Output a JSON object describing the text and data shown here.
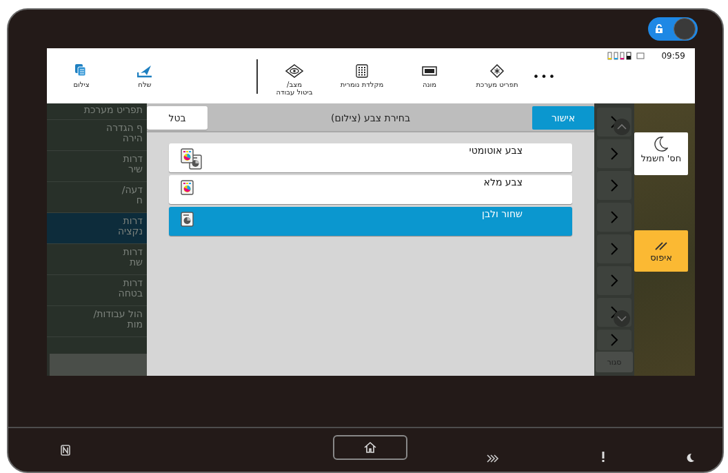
{
  "lock_toggle": {
    "on": true
  },
  "status_bar": {
    "time": "09:59"
  },
  "top_bar": {
    "more": "•••",
    "functions": [
      {
        "kind": "system-menu",
        "label": "תפריט מערכת"
      },
      {
        "kind": "counter",
        "label": "מונה"
      },
      {
        "kind": "keypad",
        "label": "מקלדת נומרית"
      },
      {
        "kind": "status",
        "label": "מצב/\nביטול עבודה"
      }
    ],
    "shortcuts": [
      {
        "kind": "send",
        "label": "שלח"
      },
      {
        "kind": "copy",
        "label": "צילום"
      }
    ]
  },
  "side_panel": [
    {
      "kind": "energy",
      "label": "חס' חשמל"
    },
    {
      "kind": "reset",
      "label": "איפוס"
    }
  ],
  "menu": {
    "items": [
      {
        "label": "תפריט מערכת",
        "selected": false
      },
      {
        "label": "ף הגדרה\nהירה",
        "selected": false
      },
      {
        "label": "דרות\nשיר",
        "selected": false
      },
      {
        "label": "דעה/\nח",
        "selected": false
      },
      {
        "label": "דרות\nנקציה",
        "selected": true
      },
      {
        "label": "דרות\nשת",
        "selected": false
      },
      {
        "label": "דרות\nבטחה",
        "selected": false
      },
      {
        "label": "הול עבודות/\nמות",
        "selected": false
      }
    ],
    "close": "סגור"
  },
  "dialog": {
    "title": "בחירת צבע (צילום)",
    "ok": "אישור",
    "cancel": "בטל",
    "options": [
      {
        "kind": "auto",
        "label": "צבע אוטומטי",
        "selected": false
      },
      {
        "kind": "color",
        "label": "צבע מלא",
        "selected": false
      },
      {
        "kind": "mono",
        "label": "שחור ולבן",
        "selected": true
      }
    ]
  }
}
